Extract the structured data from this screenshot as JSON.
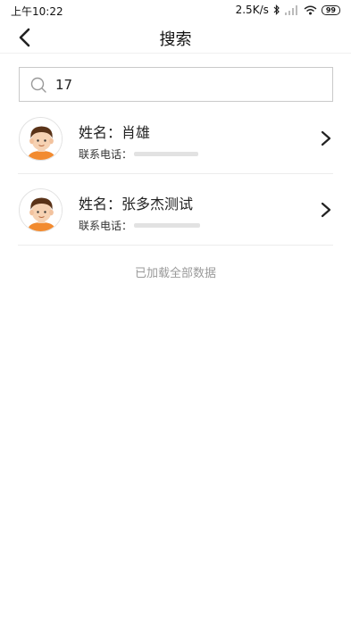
{
  "status_bar": {
    "time": "上午10:22",
    "network_speed": "2.5K/s",
    "battery": "99"
  },
  "nav": {
    "title": "搜索"
  },
  "search": {
    "value": "17",
    "placeholder": ""
  },
  "results": [
    {
      "name_label": "姓名：",
      "name": "肖雄",
      "phone_label": "联系电话："
    },
    {
      "name_label": "姓名：",
      "name": "张多杰测试",
      "phone_label": "联系电话："
    }
  ],
  "footer": {
    "text": "已加载全部数据"
  },
  "colors": {
    "avatar_shirt": "#f28b30",
    "avatar_hair": "#5a3318",
    "avatar_skin": "#f6d2b3"
  },
  "icons": [
    "back-arrow-icon",
    "search-icon",
    "chevron-right-icon",
    "bluetooth-icon",
    "signal-icon",
    "wifi-icon",
    "battery-icon"
  ]
}
